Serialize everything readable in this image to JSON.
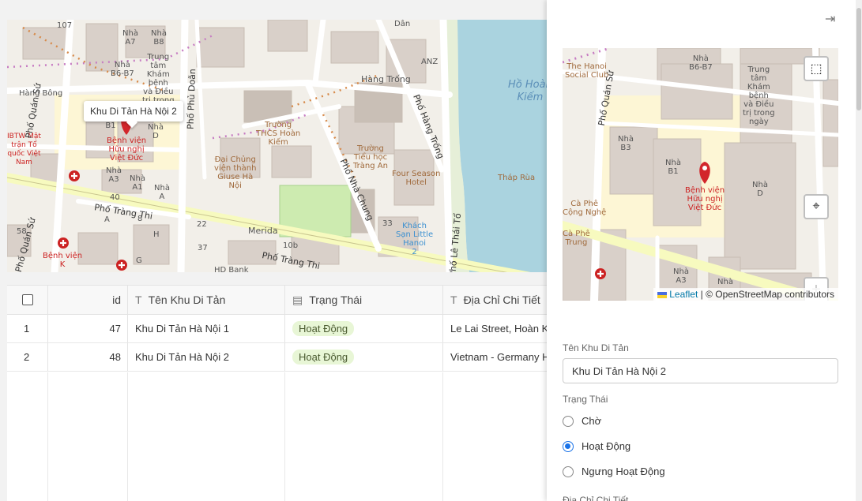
{
  "map_main": {
    "popup": "Khu Di Tản Hà Nội 2",
    "labels": {
      "hang_bong": "Hàng Bông",
      "nha_a7": "Nhà\nA7",
      "nha_b8": "Nhà\nB8",
      "trung_tam": "Trung\ntâm\nKhám\nbệnh\nvà Điều\ntrị trong\nngày",
      "nha_b6b7": "Nhà\nB6-B7",
      "nha_b1": "Nhà\nB1",
      "nha_d": "Nhà\nD",
      "benh_vien": "Bệnh viện\nHữu nghị\nViệt Đức",
      "nha_a3": "Nhà\nA3",
      "nha_a1": "Nhà\nA1",
      "nha_a": "Nhà\nA",
      "ibtw": "IBTW Mặt\ntrận Tổ\nquốc Việt\nNam",
      "pho_trang_thi_1": "Phố Tràng Thi",
      "pho_trang_thi_2": "Phố Tràng Thi",
      "pho_quan_su": "Phố Quán Sứ",
      "pho_phu_doan": "Phố Phủ Doãn",
      "pho_nha_chung": "Phố Nhà Chung",
      "pho_hang_trong": "Phố Hàng Trống",
      "pho_le_thai_to": "Phố Lê Thái Tổ",
      "hang_trong": "Hàng Trống",
      "truong_thcs": "Trường\nTHCS Hoàn\nKiếm",
      "truong_tieu_hoc": "Trường\nTiểu học\nTràng An",
      "dai_chung": "Đại Chủng\nviện thành\nGiuse Hà\nNội",
      "four_season": "Four Season\nHotel",
      "khach_san": "Khách\nSạn Little\nHanoi\n2",
      "thap_rua": "Tháp Rùa",
      "ho_hoan_kiem": "Hồ Hoàn\nKiếm",
      "merida": "Merida",
      "hd_bank": "HD Bank",
      "benh_vien_k": "Bệnh viện\nK",
      "anz": "ANZ",
      "dan": "Dân",
      "n107": "107",
      "n40": "40",
      "n58": "58",
      "n22": "22",
      "n37": "37",
      "n10b": "10b",
      "n33": "33",
      "n_g": "G",
      "n_h": "H",
      "n_a": "A",
      "n_8": "8"
    }
  },
  "table": {
    "columns": [
      "id",
      "Tên Khu Di Tản",
      "Trạng Thái",
      "Địa Chỉ Chi Tiết"
    ],
    "rows": [
      {
        "index": "1",
        "id": "47",
        "name": "Khu Di Tản Hà Nội 1",
        "status": "Hoạt Động",
        "address": "Le Lai Street, Hoàn Kiếm"
      },
      {
        "index": "2",
        "id": "48",
        "name": "Khu Di Tản Hà Nội 2",
        "status": "Hoạt Động",
        "address": "Vietnam - Germany Hospital"
      }
    ]
  },
  "panel": {
    "map_mini": {
      "labels": {
        "hanoi_social": "The Hanoi\nSocial Club",
        "nha_b6b7": "Nhà\nB6-B7",
        "trung_tam": "Trung\ntâm\nKhám\nbệnh\nvà Điều\ntrị trong\nngày",
        "nha_b3": "Nhà\nB3",
        "nha_b1": "Nhà\nB1",
        "nha_d": "Nhà\nD",
        "benh_vien": "Bệnh viện\nHữu nghị\nViệt Đức",
        "pho_quan_su": "Phố Quán Sứ",
        "ca_phe_cong_nghe": "Cà Phê\nCộng Nghệ",
        "ca_phe_trung": "Cà Phê\nTrung",
        "nha_a3": "Nhà\nA3",
        "nha": "Nhà"
      },
      "attribution_leaflet": "Leaflet",
      "attribution_rest": "| © OpenStreetMap contributors",
      "zoom_in": "+",
      "zoom_out": "−"
    },
    "name_label": "Tên Khu Di Tản",
    "name_value": "Khu Di Tản Hà Nội 2",
    "status_label": "Trạng Thái",
    "status_options": [
      "Chờ",
      "Hoạt Động",
      "Ngưng Hoạt Động"
    ],
    "status_selected": "Hoạt Động",
    "address_label": "Địa Chỉ Chi Tiết"
  }
}
